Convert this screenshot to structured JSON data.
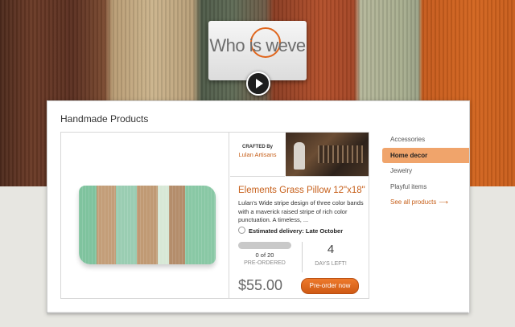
{
  "brand": {
    "logo_text": "Who is weve",
    "accent_color": "#e0661d"
  },
  "video": {
    "icon": "play-icon"
  },
  "section": {
    "title": "Handmade Products"
  },
  "product": {
    "crafted_by_label": "CRAFTED By",
    "maker": "Lulan Artisans",
    "title": "Elements Grass Pillow 12\"x18\"",
    "description": "Lulan's Wide stripe design of three color bands with a maverick raised stripe of rich color punctuation. A timeless, ...",
    "delivery": "Estimated delivery: Late October",
    "preordered_count": "0 of 20",
    "preordered_fraction": 0,
    "preordered_label": "PRE-ORDERED",
    "days_left": "4",
    "days_left_label": "DAYS LEFT!",
    "price": "$55.00",
    "preorder_button": "Pre-order now"
  },
  "sidebar": {
    "items": [
      {
        "label": "Accessories"
      },
      {
        "label": "Home decor",
        "active": true
      },
      {
        "label": "Jewelry"
      },
      {
        "label": "Playful items"
      }
    ],
    "see_all": "See all products",
    "see_all_icon": "arrow-right-icon"
  }
}
